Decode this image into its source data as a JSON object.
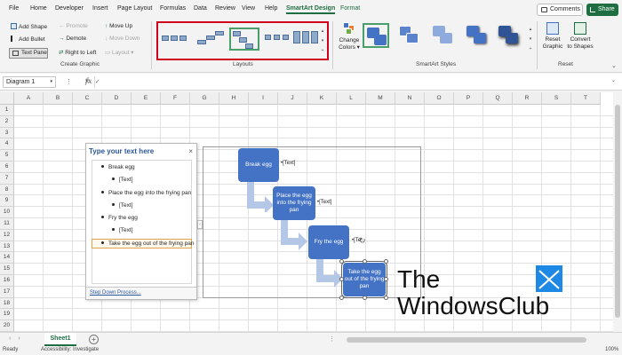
{
  "menu": {
    "tabs": [
      {
        "label": "File"
      },
      {
        "label": "Home"
      },
      {
        "label": "Developer"
      },
      {
        "label": "Insert"
      },
      {
        "label": "Page Layout"
      },
      {
        "label": "Formulas"
      },
      {
        "label": "Data"
      },
      {
        "label": "Review"
      },
      {
        "label": "View"
      },
      {
        "label": "Help"
      },
      {
        "label": "SmartArt Design"
      },
      {
        "label": "Format"
      }
    ],
    "active_tab": "SmartArt Design",
    "comments_label": "Comments",
    "share_label": "Share"
  },
  "ribbon": {
    "create_graphic": {
      "add_shape": "Add Shape",
      "add_bullet": "Add Bullet",
      "text_pane": "Text Pane",
      "promote": "Promote",
      "demote": "Demote",
      "right_to_left": "Right to Left",
      "move_up": "Move Up",
      "move_down": "Move Down",
      "layout": "Layout",
      "group_label": "Create Graphic"
    },
    "layouts": {
      "group_label": "Layouts"
    },
    "styles": {
      "change_colors_line1": "Change",
      "change_colors_line2": "Colors",
      "group_label": "SmartArt Styles"
    },
    "reset": {
      "reset_graphic_line1": "Reset",
      "reset_graphic_line2": "Graphic",
      "convert_line1": "Convert",
      "convert_line2": "to Shapes",
      "group_label": "Reset"
    }
  },
  "formula_bar": {
    "name_box": "Diagram 1",
    "fx": "fx",
    "content": ""
  },
  "grid": {
    "columns": [
      "A",
      "B",
      "C",
      "D",
      "E",
      "F",
      "G",
      "H",
      "I",
      "J",
      "K",
      "L",
      "M",
      "N",
      "O",
      "P",
      "Q",
      "R",
      "S",
      "T"
    ],
    "rows": [
      "1",
      "2",
      "3",
      "4",
      "5",
      "6",
      "7",
      "8",
      "9",
      "10",
      "11",
      "12",
      "13",
      "14",
      "15",
      "16",
      "17",
      "18",
      "19",
      "20"
    ]
  },
  "text_pane": {
    "title": "Type your text here",
    "close": "×",
    "items": [
      {
        "text": "Break egg",
        "level": 1
      },
      {
        "text": "[Text]",
        "level": 2
      },
      {
        "text": "Place the egg into the frying pan",
        "level": 1
      },
      {
        "text": "[Text]",
        "level": 2
      },
      {
        "text": "Fry the egg",
        "level": 1
      },
      {
        "text": "[Text]",
        "level": 2
      },
      {
        "text": "Take the egg out of the frying pan",
        "level": 1
      }
    ],
    "footer": "Step Down Process..."
  },
  "smartart": {
    "steps": [
      {
        "label": "Break egg",
        "sub": "•[Text]"
      },
      {
        "label": "Place the egg into the frying pan",
        "sub": "•[Text]"
      },
      {
        "label": "Fry the egg",
        "sub": "•[Te"
      },
      {
        "label": "Take the egg out of the frying pan",
        "sub": ""
      }
    ],
    "box_color": "#4472c4",
    "arrow_color": "#b4c7e7"
  },
  "watermark": {
    "line1": "The",
    "line2": "WindowsClub"
  },
  "sheets": {
    "tabs": [
      {
        "label": "Sheet1"
      }
    ],
    "add": "+"
  },
  "status": {
    "ready": "Ready",
    "accessibility": "Accessibility: Investigate",
    "zoom": "100%"
  },
  "colors": {
    "accent": "#1e6e42",
    "highlight_box": "#d0021b"
  }
}
